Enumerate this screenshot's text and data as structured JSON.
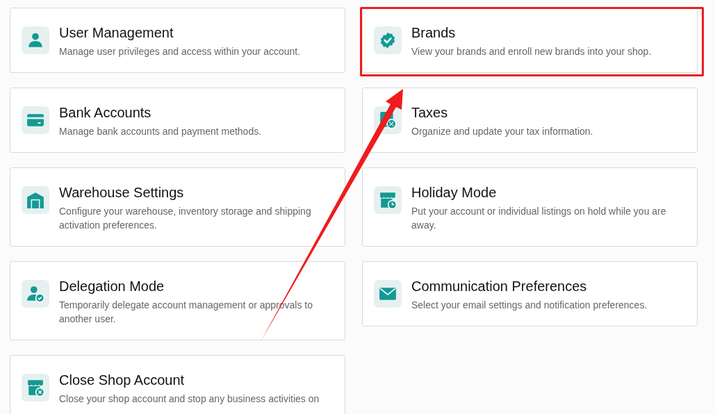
{
  "cards": [
    {
      "title": "User Management",
      "description": "Manage user privileges and access within your account.",
      "highlighted": false
    },
    {
      "title": "Brands",
      "description": "View your brands and enroll new brands into your shop.",
      "highlighted": true
    },
    {
      "title": "Bank Accounts",
      "description": "Manage bank accounts and payment methods.",
      "highlighted": false
    },
    {
      "title": "Taxes",
      "description": "Organize and update your tax information.",
      "highlighted": false
    },
    {
      "title": "Warehouse Settings",
      "description": "Configure your warehouse, inventory storage and shipping activation preferences.",
      "highlighted": false
    },
    {
      "title": "Holiday Mode",
      "description": "Put your account or individual listings on hold while you are away.",
      "highlighted": false
    },
    {
      "title": "Delegation Mode",
      "description": "Temporarily delegate account management or approvals to another user.",
      "highlighted": false
    },
    {
      "title": "Communication Preferences",
      "description": "Select your email settings and notification preferences.",
      "highlighted": false
    },
    {
      "title": "Close Shop Account",
      "description": "Close your shop account and stop any business activities on",
      "highlighted": false
    }
  ],
  "annotation": {
    "kind": "arrow"
  }
}
